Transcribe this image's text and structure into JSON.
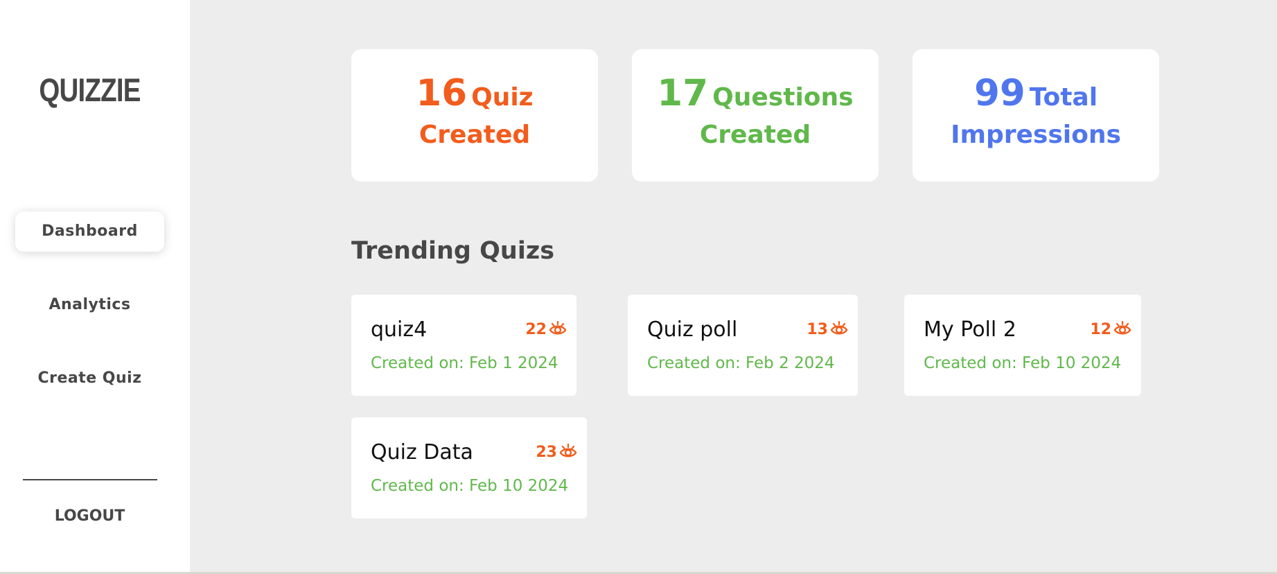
{
  "app": {
    "logo": "QUIZZIE"
  },
  "sidebar": {
    "items": [
      {
        "label": "Dashboard",
        "active": true
      },
      {
        "label": "Analytics",
        "active": false
      },
      {
        "label": "Create Quiz",
        "active": false
      }
    ],
    "logout_label": "LOGOUT"
  },
  "stats": [
    {
      "number": "16",
      "word1": "Quiz",
      "word2": "Created",
      "color": "#f25c1c"
    },
    {
      "number": "17",
      "word1": "Questions",
      "word2": "Created",
      "color": "#60b84b"
    },
    {
      "number": "99",
      "word1": "Total",
      "word2": "Impressions",
      "color": "#5076ee"
    }
  ],
  "trending": {
    "title": "Trending Quizs",
    "quizzes": [
      {
        "name": "quiz4",
        "views": "22",
        "date": "Created on: Feb 1 2024"
      },
      {
        "name": "Quiz poll",
        "views": "13",
        "date": "Created on: Feb 2 2024"
      },
      {
        "name": "My Poll 2",
        "views": "12",
        "date": "Created on: Feb 10 2024"
      },
      {
        "name": "Quiz Data",
        "views": "23",
        "date": "Created on: Feb 10 2024"
      }
    ],
    "icon": "eye-icon"
  },
  "colors": {
    "orange": "#f25c1c",
    "green": "#60b84b",
    "blue": "#5076ee",
    "text_dark": "#474747",
    "main_bg": "#ededed"
  }
}
